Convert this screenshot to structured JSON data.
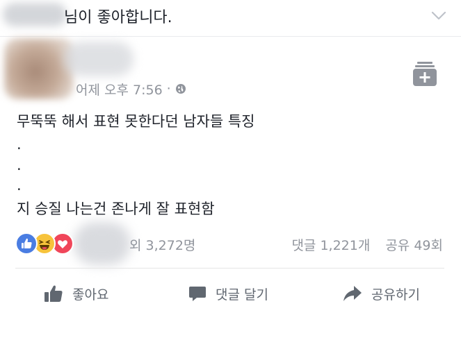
{
  "top_notice": {
    "text": "님이 좋아합니다."
  },
  "post": {
    "timestamp": "어제 오후 7:56",
    "separator": "·",
    "privacy_icon": "globe-icon",
    "save_icon": "save-icon",
    "lines": [
      "무뚝뚝 해서 표현 못한다던 남자들 특징",
      ".",
      ".",
      ".",
      "지 승질 나는건 존나게 잘 표현함"
    ]
  },
  "stats": {
    "reaction_icons": [
      "like-reaction-icon",
      "haha-reaction-icon",
      "love-reaction-icon"
    ],
    "reaction_count": "외 3,272명",
    "comments": "댓글 1,221개",
    "shares": "공유 49회"
  },
  "actions": {
    "like": "좋아요",
    "comment": "댓글 달기",
    "share": "공유하기"
  },
  "colors": {
    "text": "#1d2129",
    "muted": "#90949c",
    "like_blue": "#4a7de2",
    "haha_yellow": "#f7c33b",
    "love_red": "#f0465a"
  }
}
